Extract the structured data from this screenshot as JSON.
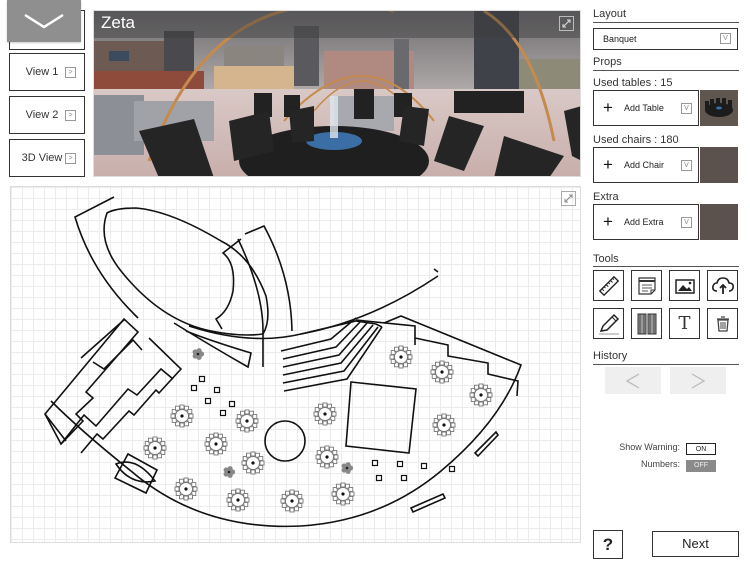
{
  "left_nav": {
    "collapse_icon": "chevron-down-icon",
    "views": [
      {
        "label": "View 1",
        "arrow": ">"
      },
      {
        "label": "View 2",
        "arrow": ">"
      },
      {
        "label": "3D View",
        "arrow": ">"
      }
    ]
  },
  "preview": {
    "title": "Zeta",
    "expand_icon": "expand-icon"
  },
  "floor_plan": {
    "expand_icon": "expand-icon",
    "round_table_count_shown": 15
  },
  "right_panel": {
    "layout_label": "Layout",
    "layout_value": "Banquet",
    "dropdown_glyph": "V",
    "props_label": "Props",
    "tables_label": "Used tables : 15",
    "add_table": "Add Table",
    "chairs_label": "Used chairs : 180",
    "add_chair": "Add Chair",
    "extra_label": "Extra",
    "add_extra": "Add Extra",
    "plus_glyph": "+",
    "tools_label": "Tools",
    "tools": [
      "ruler-icon",
      "notes-icon",
      "image-icon",
      "cloud-upload-icon",
      "pencil-icon",
      "curtain-icon",
      "text-icon",
      "trash-icon"
    ],
    "text_tool_glyph": "T",
    "history_label": "History",
    "undo_glyph": "<",
    "redo_glyph": ">",
    "show_warning_label": "Show Warning:",
    "show_warning_value": "ON",
    "numbers_label": "Numbers:",
    "numbers_value": "OFF",
    "help_label": "?",
    "next_label": "Next"
  },
  "colors": {
    "accent_gray": "#8f8f8f",
    "thumb_brown": "#5c524d",
    "toggle_off": "#8a8a8a"
  }
}
